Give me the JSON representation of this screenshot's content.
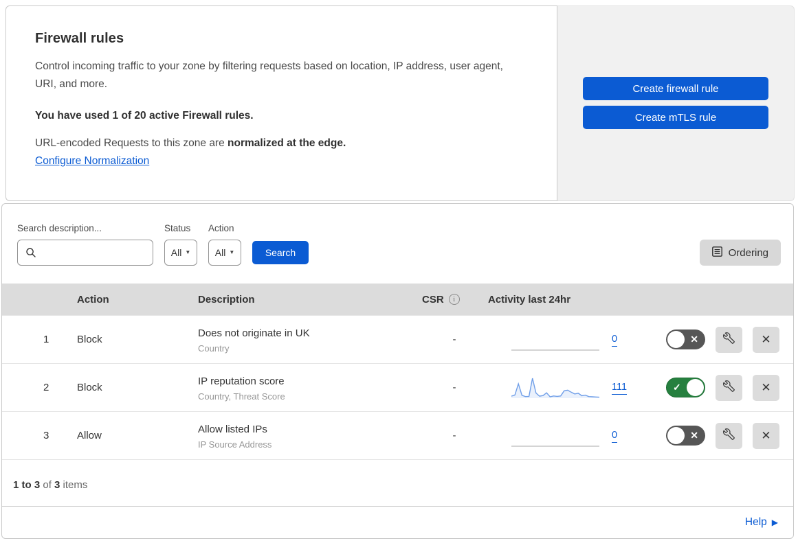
{
  "header": {
    "title": "Firewall rules",
    "description": "Control incoming traffic to your zone by filtering requests based on location, IP address, user agent, URI, and more.",
    "usage": "You have used 1 of 20 active Firewall rules.",
    "norm_prefix": "URL-encoded Requests to this zone are ",
    "norm_bold": "normalized at the edge.",
    "norm_link": "Configure Normalization",
    "buttons": [
      {
        "label": "Create firewall rule"
      },
      {
        "label": "Create mTLS rule"
      }
    ]
  },
  "filters": {
    "search_label": "Search description...",
    "status_label": "Status",
    "status_value": "All",
    "action_label": "Action",
    "action_value": "All",
    "search_button": "Search",
    "ordering_label": "Ordering"
  },
  "table": {
    "columns": {
      "action": "Action",
      "description": "Description",
      "csr": "CSR",
      "activity": "Activity last 24hr"
    },
    "rows": [
      {
        "index": "1",
        "action": "Block",
        "description": "Does not originate in UK",
        "fields": "Country",
        "csr": "-",
        "activity_count": "0",
        "enabled": false,
        "sparkline": []
      },
      {
        "index": "2",
        "action": "Block",
        "description": "IP reputation score",
        "fields": "Country, Threat Score",
        "csr": "-",
        "activity_count": "111",
        "enabled": true,
        "sparkline": [
          10,
          16,
          72,
          14,
          8,
          9,
          100,
          26,
          10,
          13,
          27,
          7,
          11,
          9,
          11,
          37,
          40,
          30,
          21,
          25,
          12,
          15,
          8,
          7,
          6,
          5
        ]
      },
      {
        "index": "3",
        "action": "Allow",
        "description": "Allow listed IPs",
        "fields": "IP Source Address",
        "csr": "-",
        "activity_count": "0",
        "enabled": false,
        "sparkline": []
      }
    ]
  },
  "footer": {
    "range": "1 to 3",
    "of_text": " of ",
    "total": "3",
    "items_text": " items"
  },
  "help": {
    "label": "Help"
  },
  "icons": {
    "info": "i",
    "caret": "▼",
    "check": "✓",
    "cross": "✕",
    "close": "✕",
    "help_arrow": "▶"
  },
  "colors": {
    "primary_blue": "#0b5bd3",
    "toggle_on_green": "#26803f",
    "toggle_off_gray": "#565656",
    "sparkline_blue": "#6f9ee8",
    "table_header_gray": "#dcdcdc",
    "side_panel_gray": "#f1f1f1"
  }
}
